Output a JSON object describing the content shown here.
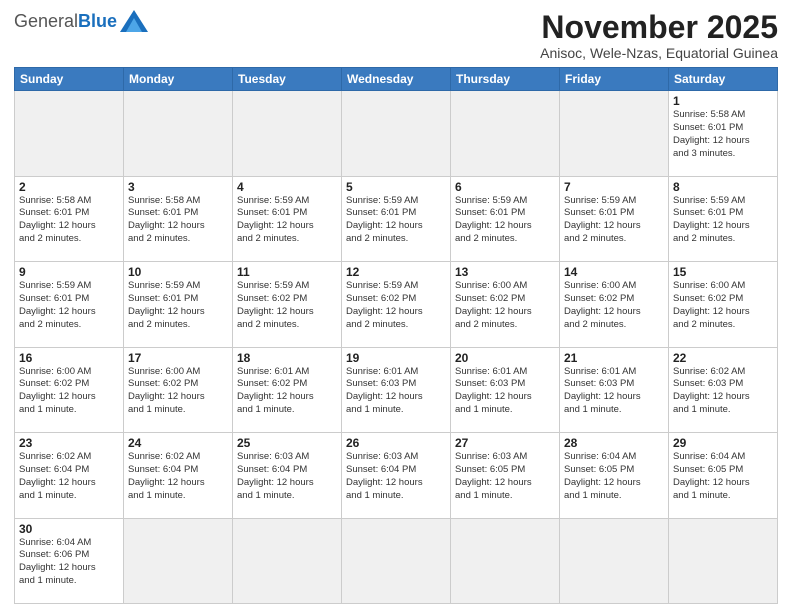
{
  "header": {
    "logo_general": "General",
    "logo_blue": "Blue",
    "month_title": "November 2025",
    "location": "Anisoc, Wele-Nzas, Equatorial Guinea"
  },
  "weekdays": [
    "Sunday",
    "Monday",
    "Tuesday",
    "Wednesday",
    "Thursday",
    "Friday",
    "Saturday"
  ],
  "weeks": [
    [
      {
        "day": "",
        "info": "",
        "empty": true
      },
      {
        "day": "",
        "info": "",
        "empty": true
      },
      {
        "day": "",
        "info": "",
        "empty": true
      },
      {
        "day": "",
        "info": "",
        "empty": true
      },
      {
        "day": "",
        "info": "",
        "empty": true
      },
      {
        "day": "",
        "info": "",
        "empty": true
      },
      {
        "day": "1",
        "info": "Sunrise: 5:58 AM\nSunset: 6:01 PM\nDaylight: 12 hours\nand 3 minutes.",
        "empty": false
      }
    ],
    [
      {
        "day": "2",
        "info": "Sunrise: 5:58 AM\nSunset: 6:01 PM\nDaylight: 12 hours\nand 2 minutes.",
        "empty": false
      },
      {
        "day": "3",
        "info": "Sunrise: 5:58 AM\nSunset: 6:01 PM\nDaylight: 12 hours\nand 2 minutes.",
        "empty": false
      },
      {
        "day": "4",
        "info": "Sunrise: 5:59 AM\nSunset: 6:01 PM\nDaylight: 12 hours\nand 2 minutes.",
        "empty": false
      },
      {
        "day": "5",
        "info": "Sunrise: 5:59 AM\nSunset: 6:01 PM\nDaylight: 12 hours\nand 2 minutes.",
        "empty": false
      },
      {
        "day": "6",
        "info": "Sunrise: 5:59 AM\nSunset: 6:01 PM\nDaylight: 12 hours\nand 2 minutes.",
        "empty": false
      },
      {
        "day": "7",
        "info": "Sunrise: 5:59 AM\nSunset: 6:01 PM\nDaylight: 12 hours\nand 2 minutes.",
        "empty": false
      },
      {
        "day": "8",
        "info": "Sunrise: 5:59 AM\nSunset: 6:01 PM\nDaylight: 12 hours\nand 2 minutes.",
        "empty": false
      }
    ],
    [
      {
        "day": "9",
        "info": "Sunrise: 5:59 AM\nSunset: 6:01 PM\nDaylight: 12 hours\nand 2 minutes.",
        "empty": false
      },
      {
        "day": "10",
        "info": "Sunrise: 5:59 AM\nSunset: 6:01 PM\nDaylight: 12 hours\nand 2 minutes.",
        "empty": false
      },
      {
        "day": "11",
        "info": "Sunrise: 5:59 AM\nSunset: 6:02 PM\nDaylight: 12 hours\nand 2 minutes.",
        "empty": false
      },
      {
        "day": "12",
        "info": "Sunrise: 5:59 AM\nSunset: 6:02 PM\nDaylight: 12 hours\nand 2 minutes.",
        "empty": false
      },
      {
        "day": "13",
        "info": "Sunrise: 6:00 AM\nSunset: 6:02 PM\nDaylight: 12 hours\nand 2 minutes.",
        "empty": false
      },
      {
        "day": "14",
        "info": "Sunrise: 6:00 AM\nSunset: 6:02 PM\nDaylight: 12 hours\nand 2 minutes.",
        "empty": false
      },
      {
        "day": "15",
        "info": "Sunrise: 6:00 AM\nSunset: 6:02 PM\nDaylight: 12 hours\nand 2 minutes.",
        "empty": false
      }
    ],
    [
      {
        "day": "16",
        "info": "Sunrise: 6:00 AM\nSunset: 6:02 PM\nDaylight: 12 hours\nand 1 minute.",
        "empty": false
      },
      {
        "day": "17",
        "info": "Sunrise: 6:00 AM\nSunset: 6:02 PM\nDaylight: 12 hours\nand 1 minute.",
        "empty": false
      },
      {
        "day": "18",
        "info": "Sunrise: 6:01 AM\nSunset: 6:02 PM\nDaylight: 12 hours\nand 1 minute.",
        "empty": false
      },
      {
        "day": "19",
        "info": "Sunrise: 6:01 AM\nSunset: 6:03 PM\nDaylight: 12 hours\nand 1 minute.",
        "empty": false
      },
      {
        "day": "20",
        "info": "Sunrise: 6:01 AM\nSunset: 6:03 PM\nDaylight: 12 hours\nand 1 minute.",
        "empty": false
      },
      {
        "day": "21",
        "info": "Sunrise: 6:01 AM\nSunset: 6:03 PM\nDaylight: 12 hours\nand 1 minute.",
        "empty": false
      },
      {
        "day": "22",
        "info": "Sunrise: 6:02 AM\nSunset: 6:03 PM\nDaylight: 12 hours\nand 1 minute.",
        "empty": false
      }
    ],
    [
      {
        "day": "23",
        "info": "Sunrise: 6:02 AM\nSunset: 6:04 PM\nDaylight: 12 hours\nand 1 minute.",
        "empty": false
      },
      {
        "day": "24",
        "info": "Sunrise: 6:02 AM\nSunset: 6:04 PM\nDaylight: 12 hours\nand 1 minute.",
        "empty": false
      },
      {
        "day": "25",
        "info": "Sunrise: 6:03 AM\nSunset: 6:04 PM\nDaylight: 12 hours\nand 1 minute.",
        "empty": false
      },
      {
        "day": "26",
        "info": "Sunrise: 6:03 AM\nSunset: 6:04 PM\nDaylight: 12 hours\nand 1 minute.",
        "empty": false
      },
      {
        "day": "27",
        "info": "Sunrise: 6:03 AM\nSunset: 6:05 PM\nDaylight: 12 hours\nand 1 minute.",
        "empty": false
      },
      {
        "day": "28",
        "info": "Sunrise: 6:04 AM\nSunset: 6:05 PM\nDaylight: 12 hours\nand 1 minute.",
        "empty": false
      },
      {
        "day": "29",
        "info": "Sunrise: 6:04 AM\nSunset: 6:05 PM\nDaylight: 12 hours\nand 1 minute.",
        "empty": false
      }
    ],
    [
      {
        "day": "30",
        "info": "Sunrise: 6:04 AM\nSunset: 6:06 PM\nDaylight: 12 hours\nand 1 minute.",
        "empty": false
      },
      {
        "day": "",
        "info": "",
        "empty": true
      },
      {
        "day": "",
        "info": "",
        "empty": true
      },
      {
        "day": "",
        "info": "",
        "empty": true
      },
      {
        "day": "",
        "info": "",
        "empty": true
      },
      {
        "day": "",
        "info": "",
        "empty": true
      },
      {
        "day": "",
        "info": "",
        "empty": true
      }
    ]
  ]
}
